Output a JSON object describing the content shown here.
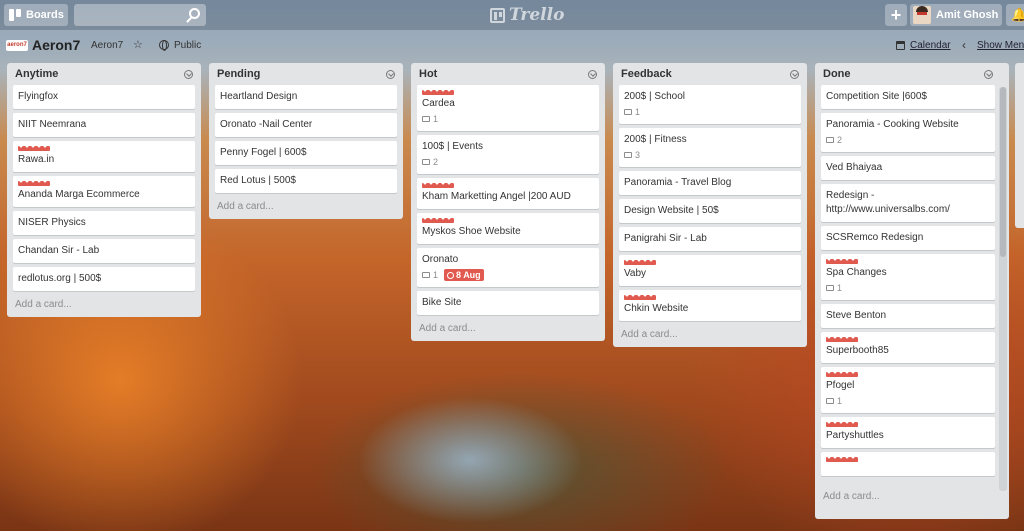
{
  "header": {
    "boards_label": "Boards",
    "logo_text": "Trello",
    "user_name": "Amit Ghosh",
    "add_label": "+",
    "notify_label": "🔔"
  },
  "board": {
    "title": "Aeron7",
    "org": "Aeron7",
    "visibility": "Public",
    "calendar_label": "Calendar",
    "menu_label": "Show Menu"
  },
  "icons": {
    "star": "☆",
    "chevron_left": "‹",
    "org_logo_text": "aeron7"
  },
  "lists": [
    {
      "title": "Anytime",
      "cards": [
        {
          "title": "Flyingfox"
        },
        {
          "title": "NIIT Neemrana"
        },
        {
          "title": "Rawa.in",
          "label": true
        },
        {
          "title": "Ananda Marga Ecommerce",
          "label": true
        },
        {
          "title": "NISER Physics"
        },
        {
          "title": "Chandan Sir - Lab"
        },
        {
          "title": "redlotus.org | 500$"
        }
      ],
      "add_label": "Add a card..."
    },
    {
      "title": "Pending",
      "cards": [
        {
          "title": "Heartland Design"
        },
        {
          "title": "Oronato -Nail Center"
        },
        {
          "title": "Penny Fogel | 600$"
        },
        {
          "title": "Red Lotus | 500$"
        }
      ],
      "add_label": "Add a card..."
    },
    {
      "title": "Hot",
      "cards": [
        {
          "title": "Cardea",
          "label": true,
          "comments": "1"
        },
        {
          "title": "100$ | Events",
          "comments": "2"
        },
        {
          "title": "Kham Marketting Angel |200 AUD",
          "label": true
        },
        {
          "title": "Myskos Shoe Website",
          "label": true
        },
        {
          "title": "Oronato",
          "comments": "1",
          "due": "8 Aug"
        },
        {
          "title": "Bike Site"
        }
      ],
      "add_label": "Add a card..."
    },
    {
      "title": "Feedback",
      "cards": [
        {
          "title": "200$ | School",
          "comments": "1"
        },
        {
          "title": "200$ | Fitness",
          "comments": "3"
        },
        {
          "title": "Panoramia - Travel Blog"
        },
        {
          "title": "Design Website | 50$"
        },
        {
          "title": "Panigrahi Sir - Lab"
        },
        {
          "title": "Vaby",
          "label": true
        },
        {
          "title": "Chkin Website",
          "label": true
        }
      ],
      "add_label": "Add a card..."
    },
    {
      "title": "Done",
      "cards": [
        {
          "title": "Competition Site |600$"
        },
        {
          "title": "Panoramia - Cooking Website",
          "comments": "2"
        },
        {
          "title": "Ved Bhaiyaa"
        },
        {
          "title": "Redesign - http://www.universalbs.com/"
        },
        {
          "title": "SCSRemco Redesign"
        },
        {
          "title": "Spa Changes",
          "label": true,
          "comments": "1"
        },
        {
          "title": "Steve Benton"
        },
        {
          "title": "Superbooth85",
          "label": true
        },
        {
          "title": "Pfogel",
          "label": true,
          "comments": "1"
        },
        {
          "title": "Partyshuttles",
          "label": true
        },
        {
          "title": "",
          "label": true
        }
      ],
      "add_label": "Add a card..."
    }
  ]
}
